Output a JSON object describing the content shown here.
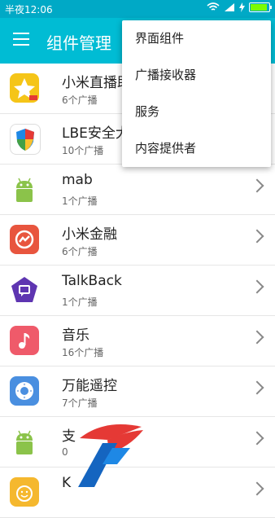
{
  "status_bar": {
    "time": "半夜12:06"
  },
  "app_bar": {
    "title": "组件管理"
  },
  "list": [
    {
      "name": "小米直播助手",
      "sub": "6个广播",
      "icon": "xiaomi-live-icon"
    },
    {
      "name": "LBE安全大师",
      "sub": "10个广播",
      "icon": "lbe-security-icon"
    },
    {
      "name": "mab",
      "sub": "1个广播",
      "icon": "android-icon"
    },
    {
      "name": "小米金融",
      "sub": "6个广播",
      "icon": "xiaomi-finance-icon"
    },
    {
      "name": "TalkBack",
      "sub": "1个广播",
      "icon": "talkback-icon"
    },
    {
      "name": "音乐",
      "sub": "16个广播",
      "icon": "music-icon"
    },
    {
      "name": "万能遥控",
      "sub": "7个广播",
      "icon": "remote-control-icon"
    },
    {
      "name": "支",
      "sub": "0",
      "icon": "android-icon"
    },
    {
      "name": "K",
      "sub": "",
      "icon": "smiley-icon"
    }
  ],
  "menu": {
    "items": [
      "界面组件",
      "广播接收器",
      "服务",
      "内容提供者"
    ]
  },
  "colors": {
    "appbar": "#00bcd4",
    "statusbar": "#00a9c6"
  }
}
